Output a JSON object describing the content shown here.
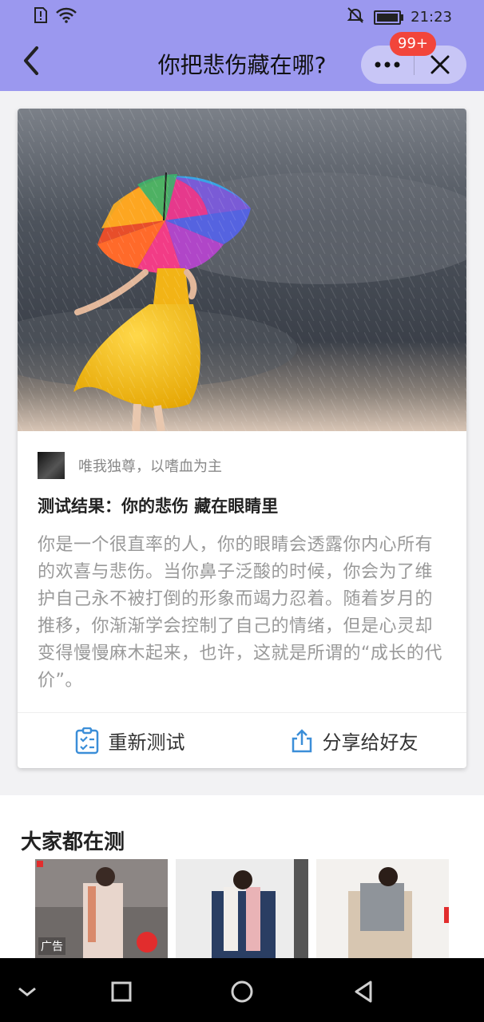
{
  "status_bar": {
    "time": "21:23"
  },
  "header": {
    "title": "你把悲伤藏在哪?",
    "badge": "99+",
    "bg_color": "#9b98ef"
  },
  "card": {
    "author": "唯我独尊，以嗜血为主",
    "result_title": "测试结果：你的悲伤 藏在眼睛里",
    "result_body": "你是一个很直率的人，你的眼睛会透露你内心所有的欢喜与悲伤。当你鼻子泛酸的时候，你会为了维护自己永不被打倒的形象而竭力忍着。随着岁月的推移，你渐渐学会控制了自己的情绪，但是心灵却变得慢慢麻木起来，也许，这就是所谓的“成长的代价”。",
    "retest_label": "重新测试",
    "share_label": "分享给好友",
    "accent_color": "#3b8ed8"
  },
  "others": {
    "section_title": "大家都在测",
    "ad_label": "广告"
  },
  "icons": [
    "back-icon",
    "more-icon",
    "close-icon",
    "checklist-icon",
    "share-icon",
    "nav-back-icon",
    "nav-home-icon",
    "nav-recents-icon",
    "nav-collapse-icon"
  ]
}
